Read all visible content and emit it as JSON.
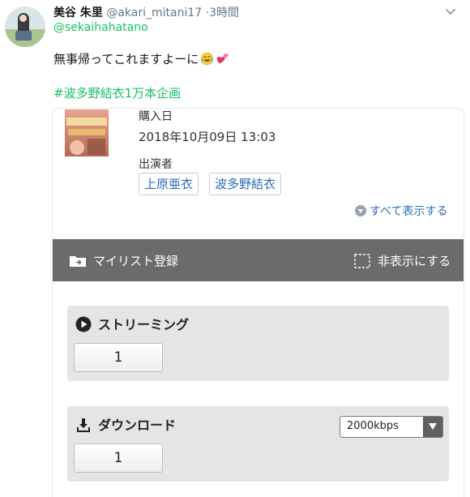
{
  "tweet": {
    "name": "美谷 朱里",
    "handle": "@akari_mitani17",
    "separator": "·",
    "time": "3時間",
    "reply_to": "@sekaihahatano",
    "text": "無事帰ってこれますよーに",
    "emojis": [
      "face-with-tears-of-joy",
      "two-hearts"
    ],
    "hashtag": "#波多野結衣1万本企画"
  },
  "card": {
    "purchase_label": "購入日",
    "purchase_date": "2018年10月09日 13:03",
    "cast_label": "出演者",
    "cast": [
      "上原亜衣",
      "波多野結衣"
    ],
    "show_all": "すべて表示する",
    "mylist_label": "マイリスト登録",
    "hide_label": "非表示にする",
    "streaming": {
      "title": "ストリーミング",
      "button": "1"
    },
    "download": {
      "title": "ダウンロード",
      "button": "1",
      "quality": "2000kbps"
    }
  },
  "colors": {
    "hashtag": "#17bf63",
    "link": "#2a6bb8",
    "bar": "#6b6b6b"
  }
}
